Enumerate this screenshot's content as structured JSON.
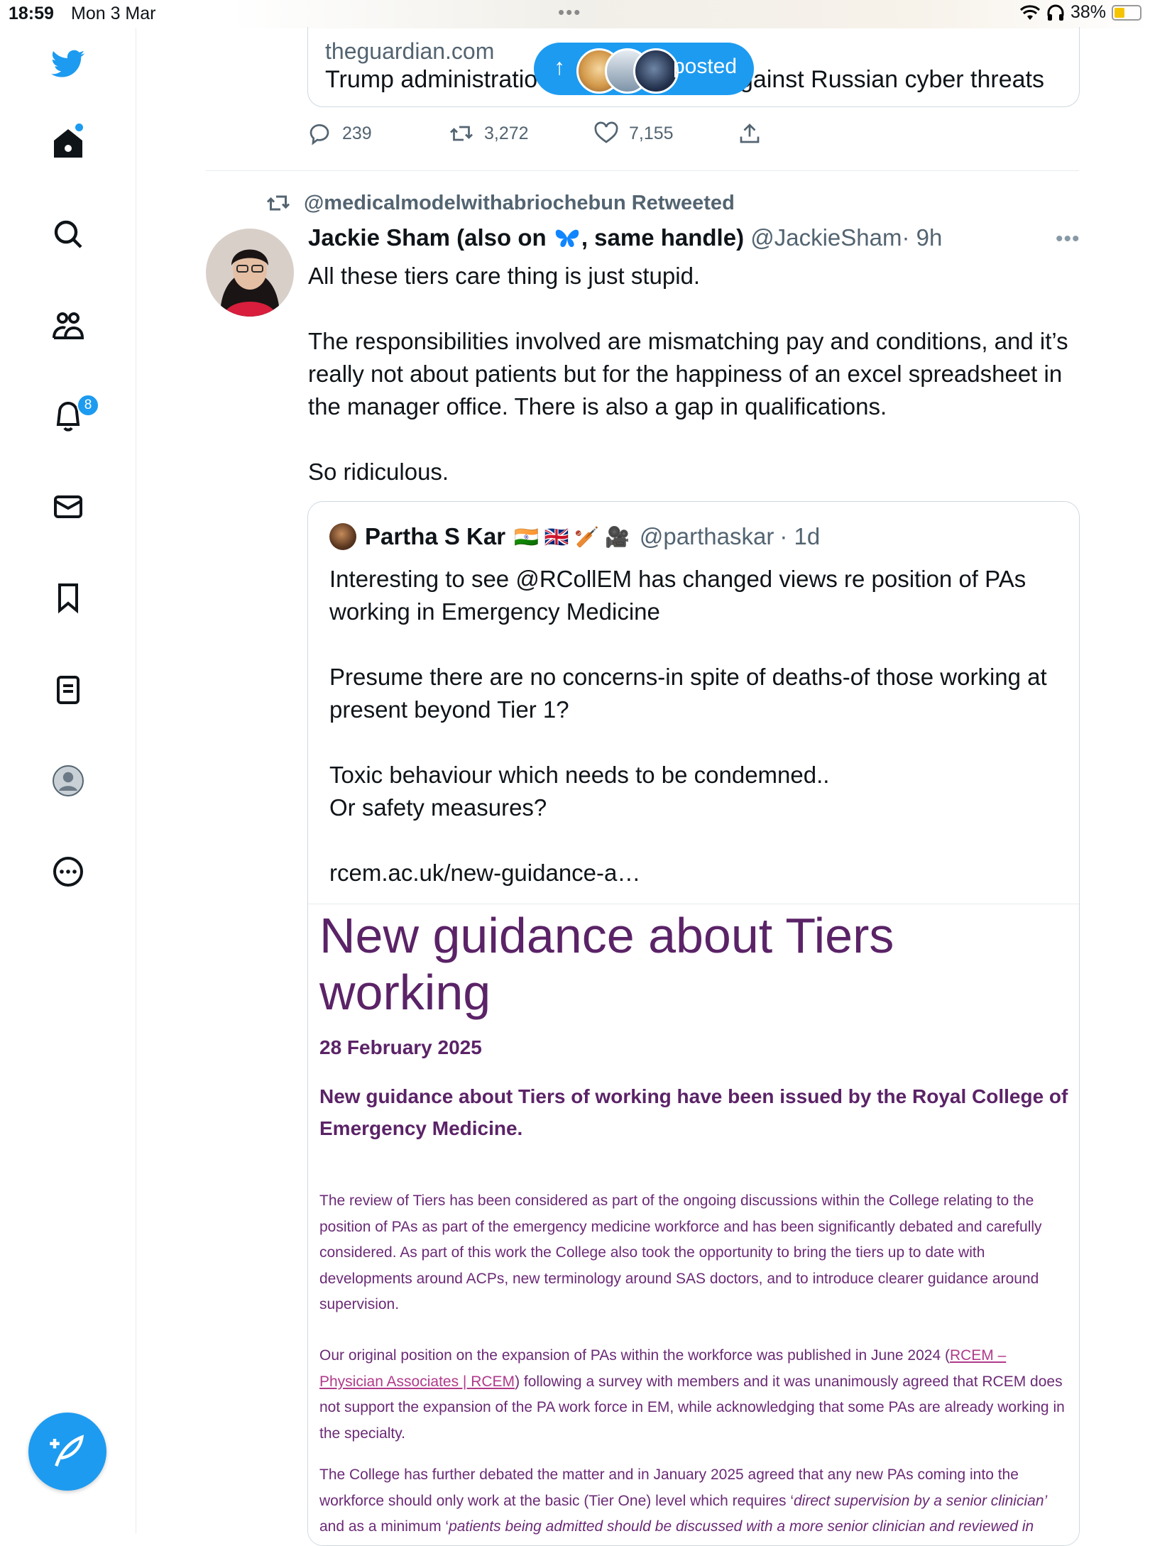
{
  "status_bar": {
    "time": "18:59",
    "date": "Mon 3 Mar",
    "battery": "38%"
  },
  "sidebar": {
    "items": [
      {
        "icon": "twitter-bird-icon"
      },
      {
        "icon": "home-icon"
      },
      {
        "icon": "search-icon"
      },
      {
        "icon": "communities-icon"
      },
      {
        "icon": "notifications-bell-icon",
        "badge": "8"
      },
      {
        "icon": "messages-envelope-icon"
      },
      {
        "icon": "bookmark-icon"
      },
      {
        "icon": "lists-icon"
      },
      {
        "icon": "profile-avatar-icon"
      },
      {
        "icon": "more-circle-icon"
      }
    ],
    "compose_icon": "compose-feather-icon"
  },
  "link_card": {
    "domain": "theguardian.com",
    "title": "Trump administration … against Russian cyber threats",
    "title_left": "Trump administratio",
    "title_right": "gainst Russian cyber threats"
  },
  "posted_pill": {
    "label": "posted"
  },
  "previous_tweet_actions": {
    "replies": "239",
    "retweets": "3,272",
    "likes": "7,155"
  },
  "tweet": {
    "retweeted_by": "@medicalmodelwithabriochebun Retweeted",
    "author_name_part1": "Jackie Sham (also on",
    "author_name_part2": ", same handle)",
    "author_handle": "@JackieSham",
    "time": "· 9h",
    "body": [
      "All these tiers care thing is just stupid.",
      "The responsibilities involved are mismatching pay and conditions, and it’s really not about patients but for the happiness of an excel spreadsheet in the manager office. There is also a gap in qualifications.",
      "So ridiculous."
    ]
  },
  "quoted_tweet": {
    "author_name": "Partha S Kar",
    "author_emojis": "🇮🇳 🇬🇧 🏏 🎥",
    "author_handle": "@parthaskar",
    "time": "· 1d",
    "body": [
      "Interesting to see @RCollEM has changed views re position of PAs working in Emergency Medicine",
      "Presume there are no concerns-in spite of deaths-of those working at present beyond Tier 1?",
      "Toxic behaviour which needs to be condemned..\nOr safety measures?",
      "rcem.ac.uk/new-guidance-a…"
    ]
  },
  "article_image": {
    "heading": "New guidance about Tiers working",
    "date": "28 February 2025",
    "lead": "New guidance about Tiers of working have been issued by the Royal College of Emergency Medicine.",
    "para1": "The review of Tiers has been considered as part of the ongoing discussions within the College relating to the position of PAs as part of the emergency medicine workforce and has been significantly debated and carefully considered. As part of this work the College also took the opportunity to bring the tiers up to date with developments around ACPs, new terminology around SAS doctors, and to introduce clearer guidance around supervision.",
    "para2_start": "Our original position on the expansion of PAs within the workforce was published in June 2024 (",
    "para2_link": "RCEM – Physician Associates | RCEM",
    "para2_end": ") following a survey with members and it was unanimously agreed that RCEM does not support the expansion of the PA work force in EM, while acknowledging that some PAs are already working in the specialty.",
    "para3_start": "The College has further debated the matter and in January 2025 agreed that any new PAs coming into the workforce should only work at the basic (Tier One) level which requires ‘",
    "para3_quote1": "direct supervision by a senior clinician’",
    "para3_mid": " and as a minimum ‘",
    "para3_quote2": "patients being admitted should be discussed with a more senior clinician and reviewed in person by a senior clinician if being discharged.”"
  },
  "colors": {
    "accent": "#1d9bf0",
    "text_secondary": "#536471",
    "article_purple": "#5b2367",
    "article_link": "#b03a8a"
  }
}
